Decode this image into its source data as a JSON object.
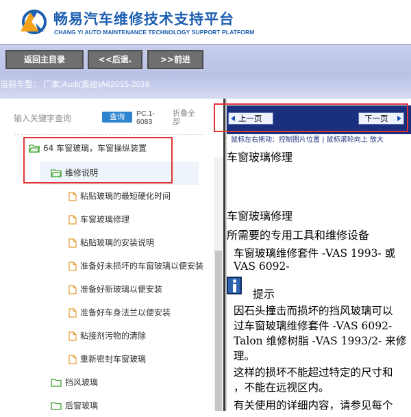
{
  "header": {
    "title": "畅易汽车维修技术支持平台",
    "subtitle": "CHANG YI AUTO MAINTENANCE TECHNOLOGY SUPPORT PLATFORM",
    "brand_color": "#1d5fb0"
  },
  "toolbar": {
    "home_label": "返回主目录",
    "back_label": "<<后退.",
    "forward_label": ">>前进"
  },
  "car_info": {
    "text": "当前车型： 厂家:Audi(奥迪)A62015-2016"
  },
  "left_panel": {
    "search_placeholder": "输入关键字查询",
    "search_button": "查询",
    "pc_code": "PC.1-6083",
    "collapse_label": "折叠全部",
    "tree": [
      {
        "label": "64 车窗玻璃，车窗操纵装置",
        "type": "folder-open",
        "level": 0
      },
      {
        "label": "维修说明",
        "type": "folder-open",
        "level": 1,
        "selected": true
      },
      {
        "label": "粘贴玻璃的最短硬化时间",
        "type": "doc",
        "level": 2
      },
      {
        "label": "车窗玻璃修理",
        "type": "doc",
        "level": 2
      },
      {
        "label": "粘贴玻璃的安装说明",
        "type": "doc",
        "level": 2
      },
      {
        "label": "准备好未损坏的车窗玻璃以便安装",
        "type": "doc",
        "level": 2
      },
      {
        "label": "准备好新玻璃以便安装",
        "type": "doc",
        "level": 2
      },
      {
        "label": "准备好车身法兰以便安装",
        "type": "doc",
        "level": 2
      },
      {
        "label": "粘接剂污物的清除",
        "type": "doc",
        "level": 2
      },
      {
        "label": "重新密封车窗玻璃",
        "type": "doc",
        "level": 2
      },
      {
        "label": "挡风玻璃",
        "type": "folder",
        "level": 1
      },
      {
        "label": "后窗玻璃",
        "type": "folder",
        "level": 1
      }
    ]
  },
  "viewer": {
    "prev_label": "上一页",
    "next_label": "下一页",
    "hint": "鼠标左右拖动：控制图片位置 | 鼠标滚轮向上 放大",
    "doc_lines": [
      "车窗玻璃修理",
      "车窗玻璃修理",
      "所需要的专用工具和维修设备",
      "车窗玻璃维修套件  -VAS 1993- 或",
      "VAS 6092-",
      "提示",
      "因石头撞击而损坏的挡风玻璃可以",
      "过车窗玻璃维修套件  -VAS 6092-",
      "Talon 维修树脂  -VAS 1993/2- 来修",
      "理。",
      "这样的损坏不能超过特定的尺寸和",
      "，不能在远视区内。",
      "有关使用的详细内容，请参见每个"
    ]
  },
  "colors": {
    "highlight_box": "#e03434",
    "nav_strip": "#1a2f7e",
    "search_button": "#2f84d0",
    "folder_icon": "#3aa02c",
    "doc_icon": "#e39a2e"
  }
}
